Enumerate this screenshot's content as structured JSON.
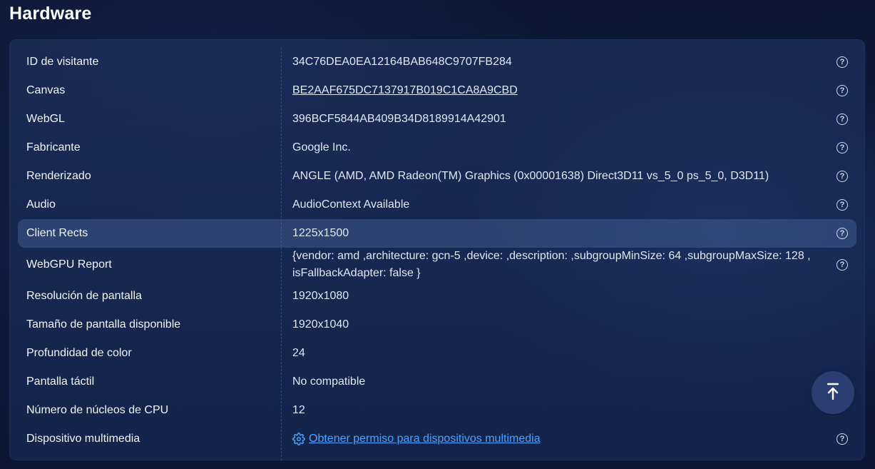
{
  "page": {
    "title": "Hardware"
  },
  "rows": [
    {
      "label": "ID de visitante",
      "value": "34C76DEA0EA12164BAB648C9707FB284"
    },
    {
      "label": "Canvas",
      "value": "BE2AAF675DC7137917B019C1CA8A9CBD"
    },
    {
      "label": "WebGL",
      "value": "396BCF5844AB409B34D8189914A42901"
    },
    {
      "label": "Fabricante",
      "value": "Google Inc."
    },
    {
      "label": "Renderizado",
      "value": "ANGLE (AMD, AMD Radeon(TM) Graphics (0x00001638) Direct3D11 vs_5_0 ps_5_0, D3D11)"
    },
    {
      "label": "Audio",
      "value": "AudioContext Available"
    },
    {
      "label": "Client Rects",
      "value": "1225x1500"
    },
    {
      "label": "WebGPU Report",
      "value": "{vendor: amd ,architecture: gcn-5 ,device: ,description: ,subgroupMinSize: 64 ,subgroupMaxSize: 128 , isFallbackAdapter: false }"
    },
    {
      "label": "Resolución de pantalla",
      "value": "1920x1080"
    },
    {
      "label": "Tamaño de pantalla disponible",
      "value": "1920x1040"
    },
    {
      "label": "Profundidad de color",
      "value": "24"
    },
    {
      "label": "Pantalla táctil",
      "value": "No compatible"
    },
    {
      "label": "Número de núcleos de CPU",
      "value": "12"
    },
    {
      "label": "Dispositivo multimedia",
      "value": "Obtener permiso para dispositivos multimedia"
    }
  ],
  "help_glyph": "?",
  "icons": {
    "help": "question-circle-icon",
    "media_permission": "gear-icon",
    "scroll_top": "arrow-up-to-top-icon"
  },
  "colors": {
    "link_blue": "#4aa3ff",
    "highlight_row": "#4b648f",
    "scroll_button": "#2b3e73"
  }
}
